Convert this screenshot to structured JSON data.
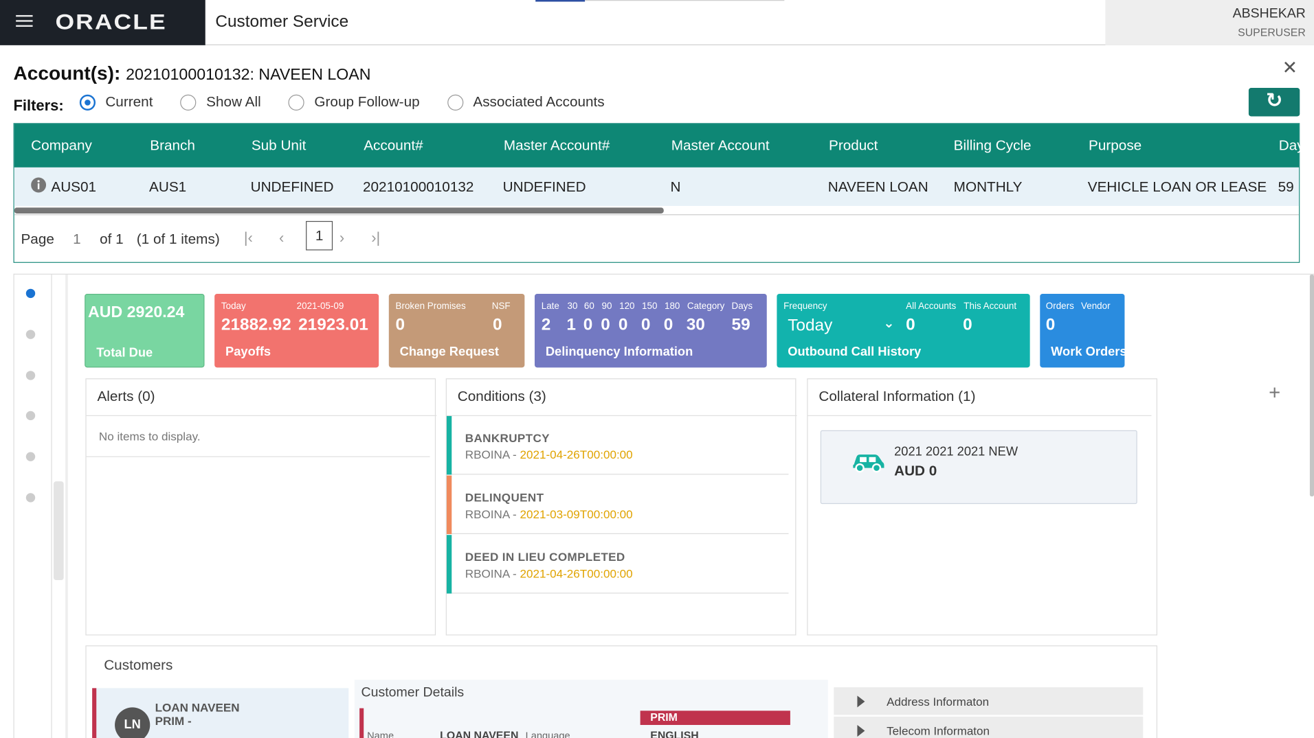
{
  "header": {
    "brand": "ORACLE",
    "app_title": "Customer Service",
    "user_name": "ABSHEKAR",
    "user_role": "SUPERUSER"
  },
  "account": {
    "label": "Account(s):",
    "value": "20210100010132: NAVEEN LOAN"
  },
  "filters": {
    "label": "Filters:",
    "options": [
      "Current",
      "Show All",
      "Group Follow-up",
      "Associated Accounts"
    ],
    "selected": "Current"
  },
  "grid": {
    "columns": [
      "Company",
      "Branch",
      "Sub Unit",
      "Account#",
      "Master Account#",
      "Master Account",
      "Product",
      "Billing Cycle",
      "Purpose",
      "Day"
    ],
    "rows": [
      [
        "AUS01",
        "AUS1",
        "UNDEFINED",
        "20210100010132",
        "UNDEFINED",
        "N",
        "NAVEEN LOAN",
        "MONTHLY",
        "VEHICLE LOAN OR LEASE",
        "59"
      ]
    ]
  },
  "pager": {
    "page_label": "Page",
    "page": "1",
    "of": "of 1",
    "items": "(1 of 1 items)",
    "current": "1"
  },
  "tiles": {
    "total_due": {
      "value": "AUD 2920.24",
      "caption": "Total Due",
      "color": "#79d6a1"
    },
    "payoffs": {
      "today_label": "Today",
      "date_label": "2021-05-09",
      "today_value": "21882.92",
      "date_value": "21923.01",
      "caption": "Payoffs",
      "color": "#f2736e"
    },
    "change_request": {
      "broken_label": "Broken Promises",
      "nsf_label": "NSF",
      "broken_value": "0",
      "nsf_value": "0",
      "caption": "Change Request",
      "color": "#c49a78"
    },
    "delinquency": {
      "labels": [
        "Late",
        "30",
        "60",
        "90",
        "120",
        "150",
        "180",
        "Category",
        "Days"
      ],
      "values": [
        "2",
        "1",
        "0",
        "0",
        "0",
        "0",
        "0",
        "30",
        "59"
      ],
      "caption": "Delinquency Information",
      "color": "#7379c2"
    },
    "outbound": {
      "freq_label": "Frequency",
      "freq_value": "Today",
      "all_label": "All Accounts",
      "this_label": "This Account",
      "all_value": "0",
      "this_value": "0",
      "caption": "Outbound Call History",
      "color": "#12b3ad"
    },
    "work_orders": {
      "orders_label": "Orders",
      "vendor_label": "Vendor",
      "value": "0",
      "caption": "Work Orders",
      "color": "#2a8cdf"
    }
  },
  "alerts": {
    "title": "Alerts (0)",
    "empty": "No items to display."
  },
  "conditions": {
    "title": "Conditions (3)",
    "items": [
      {
        "name": "BANKRUPTCY",
        "by": "RBOINA - ",
        "date": "2021-04-26T00:00:00",
        "color": "#17b3a3"
      },
      {
        "name": "DELINQUENT",
        "by": "RBOINA - ",
        "date": "2021-03-09T00:00:00",
        "color": "#f08a5d"
      },
      {
        "name": "DEED IN LIEU COMPLETED",
        "by": "RBOINA - ",
        "date": "2021-04-26T00:00:00",
        "color": "#17b3a3"
      }
    ]
  },
  "collateral": {
    "title": "Collateral Information (1)",
    "desc": "2021 2021 2021 NEW",
    "amount": "AUD 0"
  },
  "customers": {
    "title": "Customers",
    "card_name": "LOAN NAVEEN",
    "card_role": "PRIM -",
    "initials": "LN",
    "details_title": "Customer Details",
    "name_label": "Name",
    "name_value": "LOAN NAVEEN",
    "language_label": "Language",
    "badge": "PRIM",
    "language_value": "ENGLISH",
    "side": [
      "Address Informaton",
      "Telecom Informaton"
    ]
  }
}
